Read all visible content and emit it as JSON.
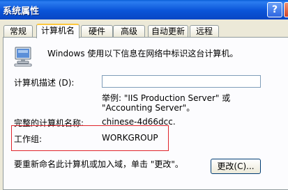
{
  "window": {
    "title": "系统属性",
    "help_glyph": "?"
  },
  "tabs": [
    "常规",
    "计算机名",
    "硬件",
    "高级",
    "自动更新",
    "远程"
  ],
  "active_tab": "计算机名",
  "description": "Windows 使用以下信息在网络中标识这台计算机。",
  "computer_description": {
    "label": "计算机描述 (D):",
    "value": "",
    "example": "举例: \"IIS Production Server\" 或\n\"Accounting Server\"。"
  },
  "full_name": {
    "label": "完整的计算机名称:",
    "value": "chinese-4d66dcc."
  },
  "workgroup": {
    "label": "工作组:",
    "value": "WORKGROUP"
  },
  "rename": {
    "text": "要重新命名此计算机或加入域，单击 \"更改\"。",
    "button_label": "更改(C)..."
  },
  "colors": {
    "titlebar": "#0a54d8",
    "highlight_box": "#e0242a",
    "active_tab_accent": "#ffc83c"
  }
}
